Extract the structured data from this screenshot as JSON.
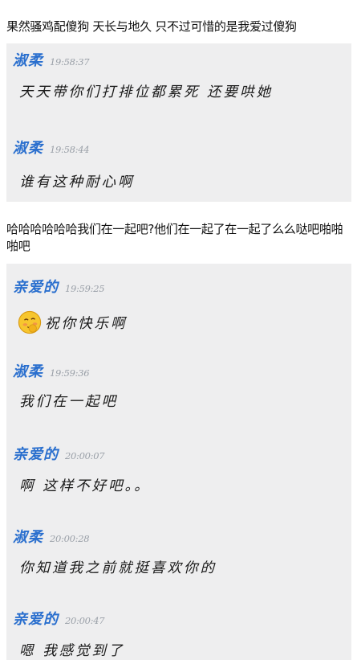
{
  "caption1": "果然骚鸡配傻狗 天长与地久 只不过可惜的是我爱过傻狗",
  "panel1": {
    "messages": [
      {
        "name": "淑柔",
        "time": "19:58:37",
        "text": "天天带你们打排位都累死 还要哄她"
      },
      {
        "name": "淑柔",
        "time": "19:58:44",
        "text": "谁有这种耐心啊"
      }
    ]
  },
  "caption2": "哈哈哈哈哈哈我们在一起吧?他们在一起了在一起了么么哒吧啪啪啪吧",
  "panel2": {
    "messages": [
      {
        "name": "亲爱的",
        "time": "19:59:25",
        "text": "祝你快乐啊",
        "emoji": "blushing-face-emoji"
      },
      {
        "name": "淑柔",
        "time": "19:59:36",
        "text": "我们在一起吧"
      },
      {
        "name": "亲爱的",
        "time": "20:00:07",
        "text": "啊 这样不好吧。。"
      },
      {
        "name": "淑柔",
        "time": "20:00:28",
        "text": "你知道我之前就挺喜欢你的"
      },
      {
        "name": "亲爱的",
        "time": "20:00:47",
        "text": "嗯 我感觉到了"
      }
    ]
  },
  "colors": {
    "name": "#2a6fce",
    "time": "#9aa0a8",
    "panel_bg": "#eeeeef",
    "text": "#1a1a1a"
  }
}
